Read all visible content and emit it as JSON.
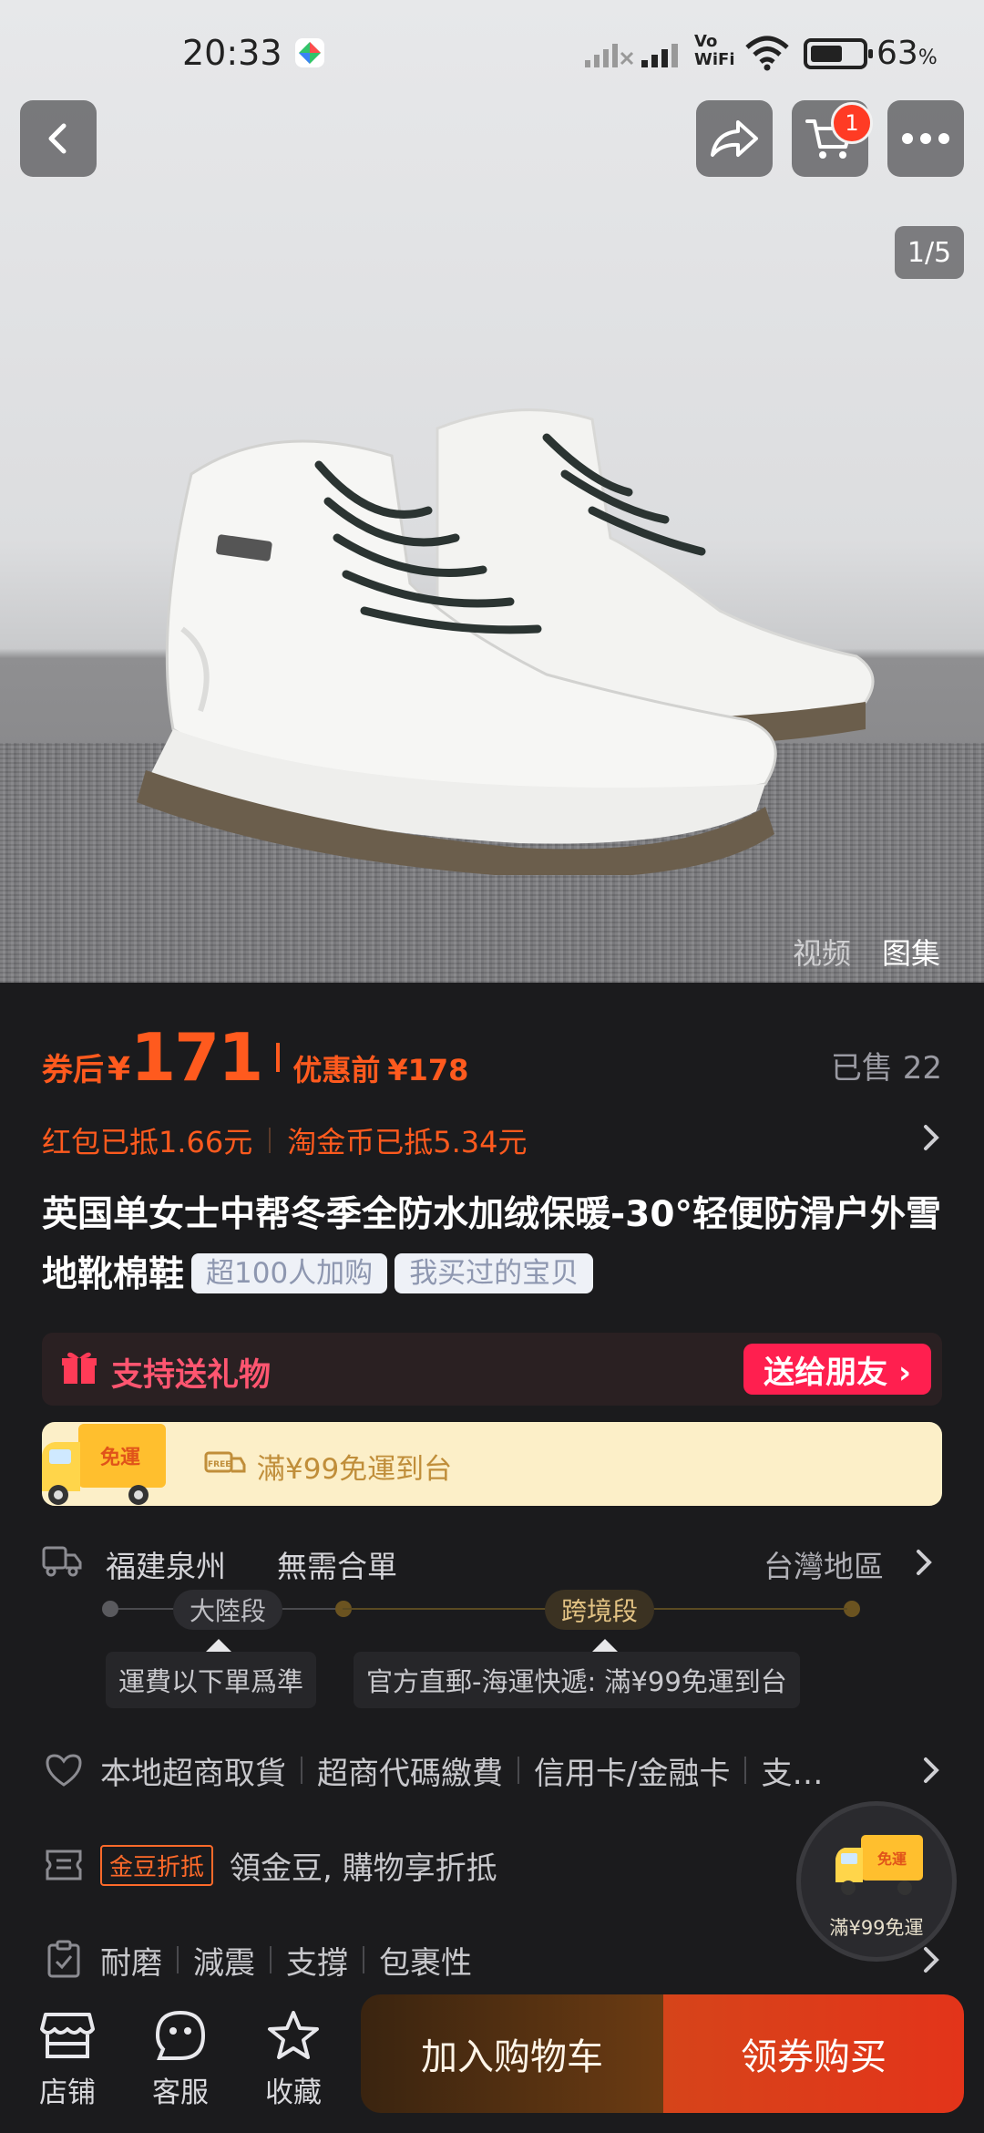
{
  "status_bar": {
    "time": "20:33",
    "vowifi_line1": "Vo",
    "vowifi_line2": "WiFi",
    "battery_percent": "63",
    "battery_unit": "%",
    "battery_level": 0.63
  },
  "top_bar": {
    "cart_count": "1"
  },
  "gallery": {
    "counter": "1/5",
    "tab_video": "视频",
    "tab_gallery": "图集"
  },
  "price": {
    "after_coupon_label": "券后",
    "currency": "¥",
    "after_coupon_value": "171",
    "before_discount_label": "优惠前",
    "before_discount_value": "¥178",
    "sold": "已售 22"
  },
  "discounts": {
    "red_packet": "红包已抵1.66元",
    "gold_coin": "淘金币已抵5.34元"
  },
  "product": {
    "title": "英国单女士中帮冬季全防水加绒保暖-30°轻便防滑户外雪地靴棉鞋",
    "tag_popular": "超100人加购",
    "tag_bought": "我买过的宝贝"
  },
  "gift": {
    "label": "支持送礼物",
    "button": "送给朋友 ›"
  },
  "shipping": {
    "truck_label": "免運",
    "free_badge": "FREE",
    "banner_text": "滿¥99免運到台",
    "origin": "福建泉州",
    "merge": "無需合單",
    "destination": "台灣地區",
    "stage_mainland": "大陸段",
    "stage_cross": "跨境段",
    "note_mainland": "運費以下單爲準",
    "note_cross": "官方直郵-海運快遞: 滿¥99免運到台"
  },
  "payments": {
    "items": [
      "本地超商取貨",
      "超商代碼繳費",
      "信用卡/金融卡",
      "支…"
    ]
  },
  "gold_bean": {
    "tag": "金豆折抵",
    "text": "領金豆, 購物享折抵"
  },
  "features": {
    "items": [
      "耐磨",
      "減震",
      "支撐",
      "包裹性"
    ]
  },
  "float_badge": {
    "truck_label": "免運",
    "text": "滿¥99免運"
  },
  "bottom_nav": {
    "store": "店铺",
    "service": "客服",
    "favorite": "收藏",
    "add_to_cart": "加入购物车",
    "buy_with_coupon": "领券购买"
  },
  "colors": {
    "accent_orange": "#ff5a1e",
    "gift_red": "#ff1f4f",
    "banner_bg": "#fcefc8",
    "cta_buy": "#e3341a"
  }
}
